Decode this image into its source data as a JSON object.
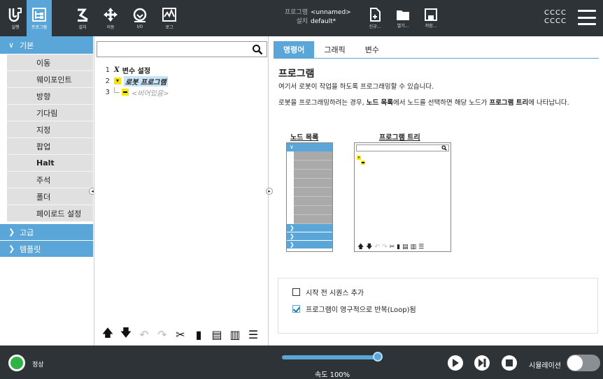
{
  "header": {
    "tabs": [
      {
        "label": "실행",
        "icon": "run-icon"
      },
      {
        "label": "프로그램",
        "icon": "program-icon",
        "active": true
      },
      {
        "label": "설치",
        "icon": "installation-icon"
      },
      {
        "label": "이동",
        "icon": "move-icon"
      },
      {
        "label": "I/O",
        "icon": "io-icon"
      },
      {
        "label": "로그",
        "icon": "log-icon"
      }
    ],
    "program_key": "프로그램",
    "program_value": "<unnamed>",
    "install_key": "설치",
    "install_value": "default*",
    "file_buttons": [
      {
        "label": "신규...",
        "icon": "new-file-icon"
      },
      {
        "label": "열기...",
        "icon": "folder-icon"
      },
      {
        "label": "저장...",
        "icon": "save-icon"
      }
    ],
    "user_line1": "CCCC",
    "user_line2": "CCCC"
  },
  "sidebar": {
    "basic_label": "기본",
    "items": [
      "이동",
      "웨이포인트",
      "방향",
      "기다림",
      "지정",
      "팝업",
      "Halt",
      "주석",
      "폴더",
      "페이로드 설정"
    ],
    "advanced_label": "고급",
    "templates_label": "템플릿"
  },
  "tree": {
    "search_placeholder": "",
    "rows": [
      {
        "num": "1",
        "icon": "variable-icon",
        "label": "변수 설정"
      },
      {
        "num": "2",
        "icon": "expand-icon",
        "label": "로봇 프로그램"
      },
      {
        "num": "3",
        "icon": "empty-node-icon",
        "label": "<비어있음>"
      }
    ]
  },
  "right": {
    "tabs": [
      "명령어",
      "그래픽",
      "변수"
    ],
    "title": "프로그램",
    "desc": "여기서 로봇이 작업을 하도록 프로그래밍할 수 있습니다.",
    "text_prefix": "로봇을 프로그래밍하려는 경우, ",
    "text_node_list": "노드 목록",
    "text_middle": "에서 노드를 선택하면 해당 노드가 ",
    "text_program_tree": "프로그램 트리",
    "text_suffix": "에 나타납니다.",
    "node_list_title": "노드 목록",
    "program_tree_title": "프로그램 트리",
    "option1": "시작 전 시퀀스 추가",
    "option1_checked": false,
    "option2": "프로그램이 영구적으로 반복(Loop)됨",
    "option2_checked": true
  },
  "footer": {
    "status": "정상",
    "speed_label": "속도 100%",
    "speed_value": 100,
    "sim_label": "시뮬레이션",
    "sim_on": false
  },
  "colors": {
    "accent": "#5ba6d8",
    "header_bg": "#2e3338",
    "status_ok": "#2fb344"
  }
}
